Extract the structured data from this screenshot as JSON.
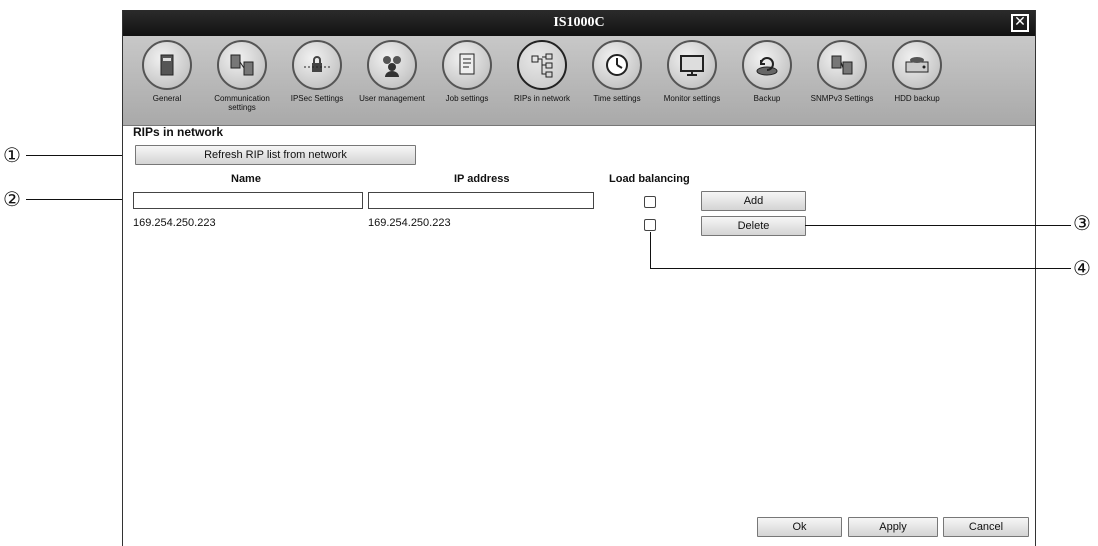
{
  "window": {
    "title": "IS1000C"
  },
  "toolbar": {
    "items": [
      {
        "label": "General",
        "icon": "rip-server-icon"
      },
      {
        "label": "Communication settings",
        "icon": "network-computers-icon"
      },
      {
        "label": "IPSec Settings",
        "icon": "lock-network-icon"
      },
      {
        "label": "User management",
        "icon": "users-icon"
      },
      {
        "label": "Job settings",
        "icon": "job-document-icon"
      },
      {
        "label": "RIPs in network",
        "icon": "rip-network-icon"
      },
      {
        "label": "Time settings",
        "icon": "clock-icon"
      },
      {
        "label": "Monitor settings",
        "icon": "monitor-icon"
      },
      {
        "label": "Backup",
        "icon": "backup-icon"
      },
      {
        "label": "SNMPv3 Settings",
        "icon": "snmp-icon"
      },
      {
        "label": "HDD backup",
        "icon": "hdd-icon"
      }
    ]
  },
  "main": {
    "title": "RIPs in network",
    "refresh_label": "Refresh RIP list from network",
    "columns": {
      "name": "Name",
      "ip": "IP address",
      "load_balancing": "Load balancing"
    },
    "new_entry": {
      "name": "",
      "ip": "",
      "load_balancing": false
    },
    "add_label": "Add",
    "delete_label": "Delete",
    "rows": [
      {
        "name": "169.254.250.223",
        "ip": "169.254.250.223",
        "load_balancing": false
      }
    ]
  },
  "footer": {
    "ok_label": "Ok",
    "apply_label": "Apply",
    "cancel_label": "Cancel"
  },
  "callouts": {
    "c1": "①",
    "c2": "②",
    "c3": "③",
    "c4": "④"
  }
}
